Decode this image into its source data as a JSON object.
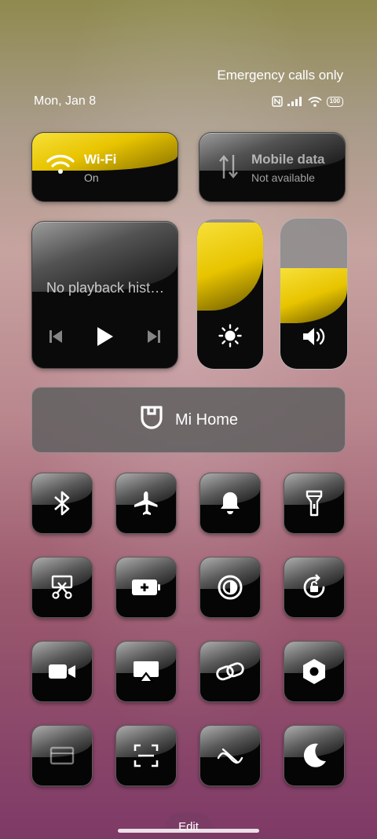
{
  "status": {
    "carrier_text": "Emergency calls only",
    "date": "Mon, Jan 8",
    "battery": "100",
    "icons": [
      "nfc-icon",
      "signal-icon",
      "wifi-icon",
      "battery-icon"
    ]
  },
  "wifi": {
    "label": "Wi-Fi",
    "status": "On",
    "icon": "wifi-icon"
  },
  "mobile_data": {
    "label": "Mobile data",
    "status": "Not available",
    "icon": "mobile-data-icon"
  },
  "media": {
    "text": "No playback hist…",
    "controls": [
      "previous-icon",
      "play-icon",
      "next-icon"
    ]
  },
  "brightness": {
    "level": 0.98,
    "icon": "brightness-icon"
  },
  "volume": {
    "level": 0.67,
    "icon": "volume-icon"
  },
  "mi_home": {
    "label": "Mi Home",
    "icon": "mi-home-icon"
  },
  "toggles": [
    {
      "name": "bluetooth",
      "icon": "bluetooth-icon"
    },
    {
      "name": "airplane-mode",
      "icon": "airplane-icon"
    },
    {
      "name": "sound",
      "icon": "bell-icon"
    },
    {
      "name": "flashlight",
      "icon": "flashlight-icon"
    },
    {
      "name": "screenshot",
      "icon": "scissors-icon"
    },
    {
      "name": "battery-saver",
      "icon": "battery-plus-icon"
    },
    {
      "name": "reading-mode",
      "icon": "contrast-icon"
    },
    {
      "name": "rotation-lock",
      "icon": "rotation-lock-icon"
    },
    {
      "name": "screen-recorder",
      "icon": "video-icon"
    },
    {
      "name": "cast",
      "icon": "cast-icon"
    },
    {
      "name": "link",
      "icon": "link-icon"
    },
    {
      "name": "settings",
      "icon": "hex-nut-icon"
    },
    {
      "name": "floating-window",
      "icon": "window-icon"
    },
    {
      "name": "scanner",
      "icon": "scan-icon"
    },
    {
      "name": "mobile-data-toggle",
      "icon": "data-saver-icon"
    },
    {
      "name": "dark-mode",
      "icon": "moon-icon"
    }
  ],
  "edit_label": "Edit",
  "colors": {
    "accent": "#e8c400",
    "tile": "#0a0a0a"
  }
}
